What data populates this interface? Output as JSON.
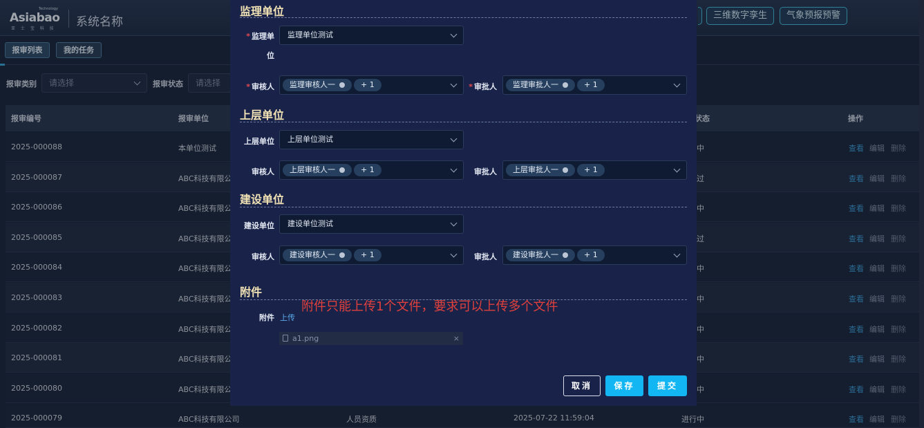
{
  "app": {
    "logo_text": "Asiabao",
    "logo_sub": "Technology",
    "logo_cn": "亚 士 宝 科 技",
    "system_name": "系统名称",
    "top_buttons": [
      "三维数字孪生",
      "气象预报预警"
    ]
  },
  "tabs": [
    "报审列表",
    "我的任务"
  ],
  "filters": {
    "type_label": "报审类别",
    "type_placeholder": "请选择",
    "status_label": "报审状态",
    "status_placeholder": "请选择"
  },
  "table": {
    "headers": {
      "no": "报审编号",
      "unit": "报审单位",
      "status": "状态",
      "ops": "操作"
    },
    "actions": {
      "view": "查看",
      "edit": "编辑",
      "delete": "删除"
    },
    "rows": [
      {
        "no": "2025-000088",
        "unit": "本单位测试",
        "status": "中"
      },
      {
        "no": "2025-000087",
        "unit": "ABC科技有限公",
        "status": "过"
      },
      {
        "no": "2025-000086",
        "unit": "ABC科技有限公",
        "status": "中"
      },
      {
        "no": "2025-000085",
        "unit": "ABC科技有限公",
        "status": "过"
      },
      {
        "no": "2025-000084",
        "unit": "ABC科技有限公",
        "status": "中"
      },
      {
        "no": "2025-000083",
        "unit": "ABC科技有限公",
        "status": "中"
      },
      {
        "no": "2025-000082",
        "unit": "ABC科技有限公",
        "status": "中"
      },
      {
        "no": "2025-000081",
        "unit": "ABC科技有限公",
        "status": "中"
      },
      {
        "no": "2025-000080",
        "unit": "ABC科技有限公",
        "status": "中"
      }
    ],
    "last_row": {
      "no": "2025-000079",
      "unit": "ABC科技有限公司",
      "type": "人员资质",
      "time": "2025-07-22 11:59:04",
      "status": "进行中"
    }
  },
  "modal": {
    "supervision": {
      "title": "监理单位",
      "unit_label_1": "监理单",
      "unit_label_2": "位",
      "unit_value": "监理单位测试",
      "reviewer_label": "审核人",
      "reviewer_tag": "监理审核人一",
      "reviewer_more": "+ 1",
      "approver_label": "审批人",
      "approver_tag": "监理审批人一",
      "approver_more": "+ 1"
    },
    "upper": {
      "title": "上层单位",
      "unit_label": "上层单位",
      "unit_value": "上层单位测试",
      "reviewer_label": "审核人",
      "reviewer_tag": "上层审核人一",
      "reviewer_more": "+ 1",
      "approver_label": "审批人",
      "approver_tag": "上层审批人一",
      "approver_more": "+ 1"
    },
    "construction": {
      "title": "建设单位",
      "unit_label": "建设单位",
      "unit_value": "建设单位测试",
      "reviewer_label": "审核人",
      "reviewer_tag": "建设审核人一",
      "reviewer_more": "+ 1",
      "approver_label": "审批人",
      "approver_tag": "建设审批人一",
      "approver_more": "+ 1"
    },
    "attachment": {
      "title": "附件",
      "label": "附件",
      "upload": "上传",
      "file_name": "a1.png",
      "note": "附件只能上传1个文件，要求可以上传多个文件"
    },
    "buttons": {
      "cancel": "取消",
      "save": "保存",
      "submit": "提交"
    }
  }
}
